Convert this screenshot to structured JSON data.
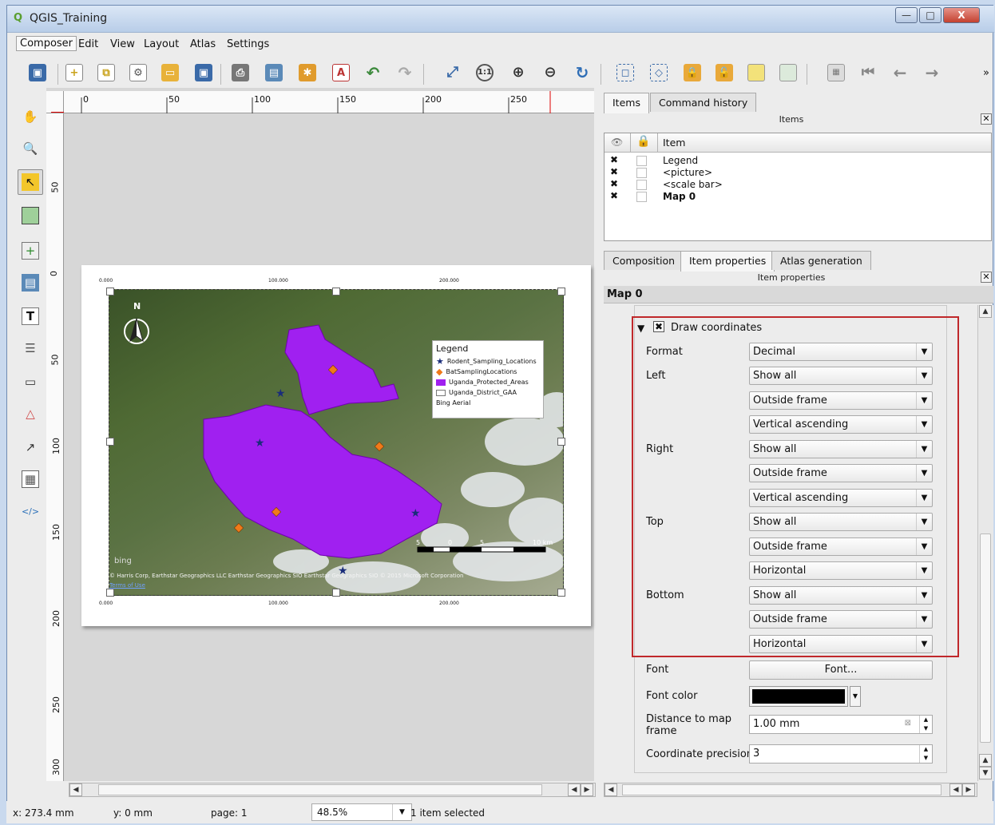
{
  "window": {
    "title": "QGIS_Training",
    "minimize": "—",
    "maximize": "□",
    "close": "X"
  },
  "menu": [
    "Composer",
    "Edit",
    "View",
    "Layout",
    "Atlas",
    "Settings"
  ],
  "toolbar": {
    "overflow": "»"
  },
  "rulers": {
    "h_labels": [
      "0",
      "50",
      "100",
      "150",
      "200",
      "250"
    ],
    "v_labels": [
      "50",
      "0",
      "50",
      "100",
      "150",
      "200",
      "250",
      "300"
    ]
  },
  "map": {
    "top_coords": [
      "0.000",
      "100.000",
      "200.000"
    ],
    "bottom_coords": [
      "0.000",
      "100.000",
      "200.000"
    ],
    "attribution": "© Harris Corp, Earthstar Geographics LLC Earthstar Geographics SIO Earthstar Geographics SIO © 2015 Microsoft Corporation",
    "terms": "Terms of Use",
    "bing": "bing",
    "scale_labels": [
      "5",
      "0",
      "5",
      "10 km"
    ],
    "north": "N"
  },
  "legend": {
    "title": "Legend",
    "entries": [
      {
        "label": "Rodent_Sampling_Locations",
        "color": "#1a2d7a"
      },
      {
        "label": "BatSamplingLocations",
        "color": "#f07a1a"
      },
      {
        "label": "Uganda_Protected_Areas",
        "color": "#a020f0"
      },
      {
        "label": "Uganda_District_GAA",
        "color": "#ffffff"
      },
      {
        "label": "Bing Aerial",
        "color": ""
      }
    ]
  },
  "dock_items": {
    "tabs": [
      "Items",
      "Command history"
    ],
    "title": "Items",
    "column": "Item",
    "rows": [
      {
        "name": "Legend",
        "checked": true
      },
      {
        "name": "<picture>",
        "checked": true
      },
      {
        "name": "<scale bar>",
        "checked": true
      },
      {
        "name": "Map 0",
        "checked": true
      }
    ]
  },
  "dock_props": {
    "tabs": [
      "Composition",
      "Item properties",
      "Atlas generation"
    ],
    "title": "Item properties",
    "header": "Map 0",
    "section": "Draw coordinates",
    "labels": {
      "format": "Format",
      "left": "Left",
      "right": "Right",
      "top": "Top",
      "bottom": "Bottom",
      "font": "Font",
      "font_color": "Font color",
      "distance": "Distance to map frame",
      "precision": "Coordinate precision"
    },
    "values": {
      "format": "Decimal",
      "left": [
        "Show all",
        "Outside frame",
        "Vertical ascending"
      ],
      "right": [
        "Show all",
        "Outside frame",
        "Vertical ascending"
      ],
      "top": [
        "Show all",
        "Outside frame",
        "Horizontal"
      ],
      "bottom": [
        "Show all",
        "Outside frame",
        "Horizontal"
      ],
      "font_button": "Font...",
      "distance": "1.00 mm",
      "precision": "3"
    },
    "accent": "#c0282b"
  },
  "status": {
    "x": "x: 273.4 mm",
    "y": "y: 0 mm",
    "page": "page: 1",
    "zoom": "48.5%",
    "selection": "1 item selected"
  }
}
